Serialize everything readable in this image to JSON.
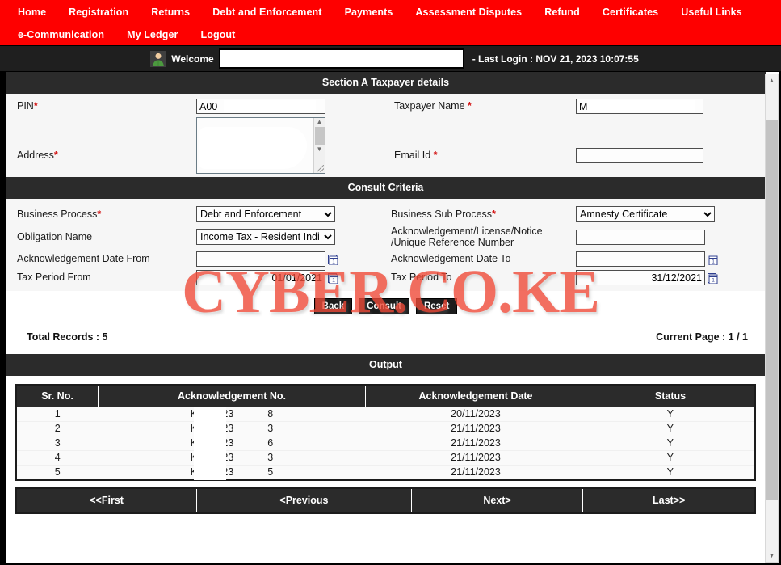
{
  "nav": {
    "row1": [
      {
        "label": "Home",
        "name": "nav-home"
      },
      {
        "label": "Registration",
        "name": "nav-registration"
      },
      {
        "label": "Returns",
        "name": "nav-returns"
      },
      {
        "label": "Debt and Enforcement",
        "name": "nav-debt-and-enforcement"
      },
      {
        "label": "Payments",
        "name": "nav-payments"
      },
      {
        "label": "Assessment Disputes",
        "name": "nav-assessment-disputes"
      },
      {
        "label": "Refund",
        "name": "nav-refund"
      },
      {
        "label": "Certificates",
        "name": "nav-certificates"
      },
      {
        "label": "Useful Links",
        "name": "nav-useful-links"
      }
    ],
    "row2": [
      {
        "label": "e-Communication",
        "name": "nav-e-communication"
      },
      {
        "label": "My Ledger",
        "name": "nav-my-ledger"
      },
      {
        "label": "Logout",
        "name": "nav-logout"
      }
    ]
  },
  "header": {
    "welcome_label": "Welcome",
    "user_name": "",
    "last_login": "- Last Login : NOV 21, 2023 10:07:55",
    "avatar_icon": "user-avatar-icon"
  },
  "section_a": {
    "title": "Section A Taxpayer details",
    "pin_label": "PIN",
    "pin_value": "A00",
    "taxpayer_name_label": "Taxpayer Name",
    "taxpayer_name_value": "M",
    "address_label": "Address",
    "address_value": "",
    "email_label": "Email Id",
    "email_value": "",
    "required_mark": "*"
  },
  "consult": {
    "title": "Consult Criteria",
    "business_process_label": "Business Process",
    "business_process_value": "Debt and Enforcement",
    "business_sub_process_label": "Business Sub Process",
    "business_sub_process_value": "Amnesty Certificate",
    "obligation_label": "Obligation Name",
    "obligation_value": "Income Tax - Resident Indi",
    "ack_ref_label_line1": "Acknowledgement/License/Notice",
    "ack_ref_label_line2": "/Unique Reference Number",
    "ack_ref_value": "",
    "ack_date_from_label": "Acknowledgement Date From",
    "ack_date_from_value": "",
    "ack_date_to_label": "Acknowledgement Date To",
    "ack_date_to_value": "",
    "tax_period_from_label": "Tax Period From",
    "tax_period_from_value": "01/01/2021",
    "tax_period_to_label": "Tax Period To",
    "tax_period_to_value": "31/12/2021",
    "calendar_icon": "calendar-icon",
    "required_mark": "*"
  },
  "buttons": {
    "back": "Back",
    "consult": "Consult",
    "reset": "Reset"
  },
  "summary": {
    "total_records": "Total Records : 5",
    "current_page": "Current Page : 1 / 1"
  },
  "output": {
    "title": "Output",
    "columns": [
      "Sr. No.",
      "Acknowledgement No.",
      "Acknowledgement Date",
      "Status"
    ],
    "rows": [
      {
        "sr": "1",
        "ack_pre": "KRA2023",
        "ack_post": "8",
        "date": "20/11/2023",
        "status": "Y"
      },
      {
        "sr": "2",
        "ack_pre": "KRA2023",
        "ack_post": "3",
        "date": "21/11/2023",
        "status": "Y"
      },
      {
        "sr": "3",
        "ack_pre": "KRA2023",
        "ack_post": "6",
        "date": "21/11/2023",
        "status": "Y"
      },
      {
        "sr": "4",
        "ack_pre": "KRA2023",
        "ack_post": "3",
        "date": "21/11/2023",
        "status": "Y"
      },
      {
        "sr": "5",
        "ack_pre": "KRA2023",
        "ack_post": "5",
        "date": "21/11/2023",
        "status": "Y"
      }
    ]
  },
  "pager": {
    "first": "<<First",
    "previous": "<Previous",
    "next": "Next>",
    "last": "Last>>"
  },
  "watermark": {
    "text": "CYBER.CO.KE"
  },
  "colors": {
    "nav_red": "#fe0000",
    "section_dark": "#2b2b2b",
    "required_red": "#d31616",
    "watermark_red": "#ef4b39"
  }
}
